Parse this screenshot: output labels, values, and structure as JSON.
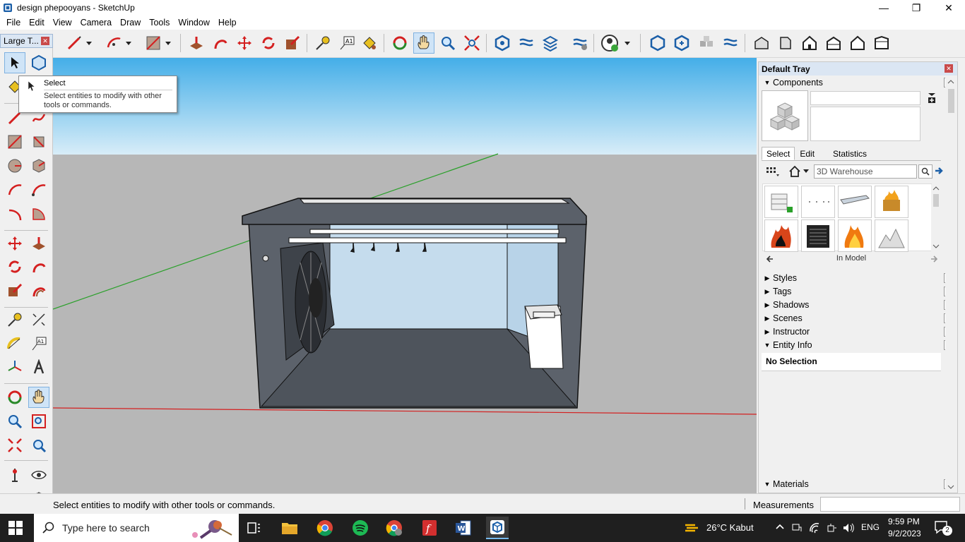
{
  "window": {
    "title": "design phepooyans - SketchUp",
    "minimize": "—",
    "restore": "❐",
    "close": "✕"
  },
  "menu": [
    "File",
    "Edit",
    "View",
    "Camera",
    "Draw",
    "Tools",
    "Window",
    "Help"
  ],
  "palette": {
    "title": "Large T...",
    "close": "✕"
  },
  "tooltip": {
    "title": "Select",
    "body": "Select entities to modify with other tools or commands."
  },
  "tray": {
    "title": "Default Tray",
    "close": "✕",
    "components": {
      "label": "Components",
      "tabs": [
        "Select",
        "Edit",
        "Statistics"
      ],
      "search_value": "3D Warehouse",
      "collection_label": "In Model"
    },
    "panels": [
      "Styles",
      "Tags",
      "Shadows",
      "Scenes",
      "Instructor"
    ],
    "entity_info": {
      "label": "Entity Info",
      "value": "No Selection"
    },
    "materials": {
      "label": "Materials"
    }
  },
  "status": {
    "text": "Select entities to modify with other tools or commands.",
    "measurements_label": "Measurements",
    "measurements_value": ""
  },
  "taskbar": {
    "search_placeholder": "Type here to search",
    "weather": "26°C  Kabut",
    "lang": "ENG",
    "time": "9:59 PM",
    "date": "9/2/2023",
    "notifications": "2"
  },
  "colors": {
    "sky_top": "#4bb2ee",
    "sky_bottom": "#d7ecf7",
    "ground": "#b6b6b6",
    "model_wall": "#5a6069",
    "axis_red": "#d42020",
    "axis_green": "#2aa02a"
  }
}
